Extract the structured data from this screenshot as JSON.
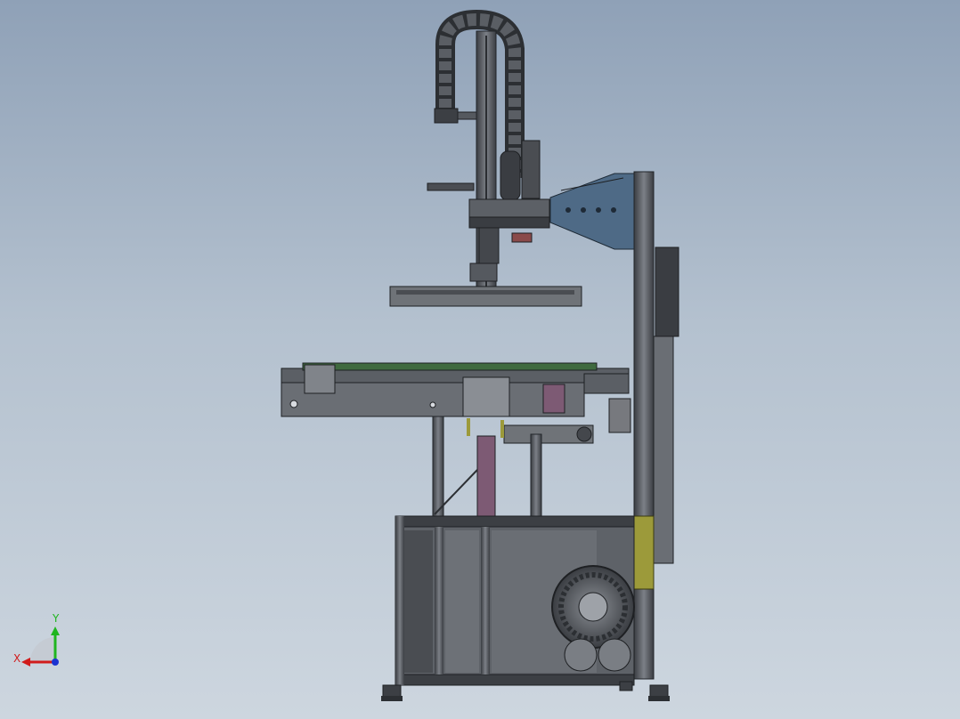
{
  "viewport": {
    "background_top": "#8fa1b7",
    "background_bottom": "#cdd6df"
  },
  "model": {
    "colors": {
      "frame": "#4b4f55",
      "frame_dark": "#2c2f33",
      "frame_light": "#8a8e94",
      "panel": "#66696e",
      "bracket_blue": "#4e6a86",
      "cylinder_purple": "#7d5a74",
      "plate_yellow": "#9c9a3a",
      "accent_red": "#8a4a4a",
      "rail_green": "#3f6a3f"
    }
  },
  "triad": {
    "x_label": "X",
    "y_label": "Y",
    "x_color": "#d11c1c",
    "y_color": "#1fb51f",
    "z_color": "#1c33d1"
  }
}
